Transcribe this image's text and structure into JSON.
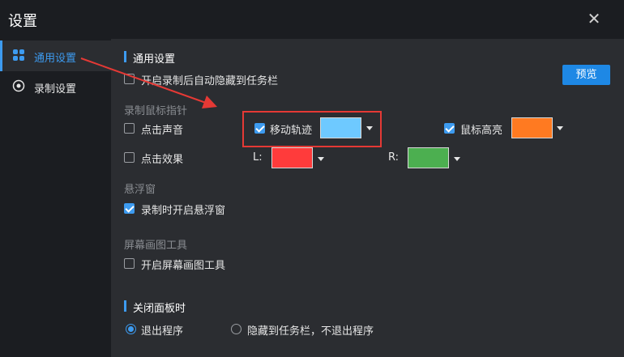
{
  "window": {
    "title": "设置",
    "close_symbol": "✕"
  },
  "sidebar": {
    "items": [
      {
        "label": "通用设置",
        "icon": "grid-icon",
        "active": true
      },
      {
        "label": "录制设置",
        "icon": "record-icon",
        "active": false
      }
    ]
  },
  "general": {
    "section_title": "通用设置",
    "auto_hide_label": "开启录制后自动隐藏到任务栏",
    "auto_hide_checked": false,
    "preview_label": "预览"
  },
  "pointer": {
    "group_label": "录制鼠标指针",
    "click_sound_label": "点击声音",
    "click_sound_checked": false,
    "move_trail_label": "移动轨迹",
    "move_trail_checked": true,
    "move_trail_color": "#6ec9ff",
    "highlight_label": "鼠标高亮",
    "highlight_checked": true,
    "highlight_color": "#ff7a21",
    "click_effect_label": "点击效果",
    "click_effect_checked": false,
    "left_label": "L:",
    "left_color": "#ff3b3b",
    "right_label": "R:",
    "right_color": "#4caf50"
  },
  "floating": {
    "group_label": "悬浮窗",
    "open_on_record_label": "录制时开启悬浮窗",
    "open_on_record_checked": true
  },
  "screen_draw": {
    "group_label": "屏幕画图工具",
    "enable_label": "开启屏幕画图工具",
    "enable_checked": false
  },
  "close_panel": {
    "section_title": "关闭面板时",
    "exit_label": "退出程序",
    "exit_selected": true,
    "hide_label": "隐藏到任务栏，不退出程序",
    "hide_selected": false
  },
  "colors": {
    "accent": "#3d9bf0",
    "annotation_red": "#e53935"
  }
}
